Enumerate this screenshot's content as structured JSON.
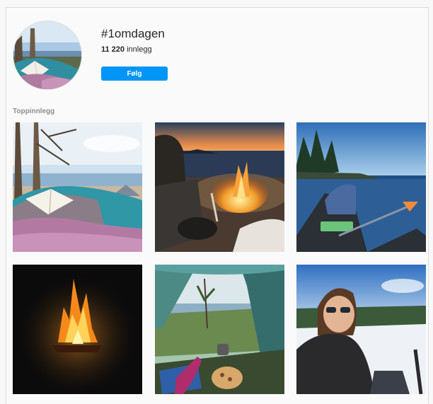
{
  "header": {
    "hashtag": "#1omdagen",
    "post_count": "11 220",
    "post_count_label": " innlegg",
    "follow_label": "Følg"
  },
  "top_posts": {
    "section_title": "Toppinnlegg"
  },
  "colors": {
    "follow_button": "#0095f6",
    "section_title": "#8e8e8e"
  }
}
